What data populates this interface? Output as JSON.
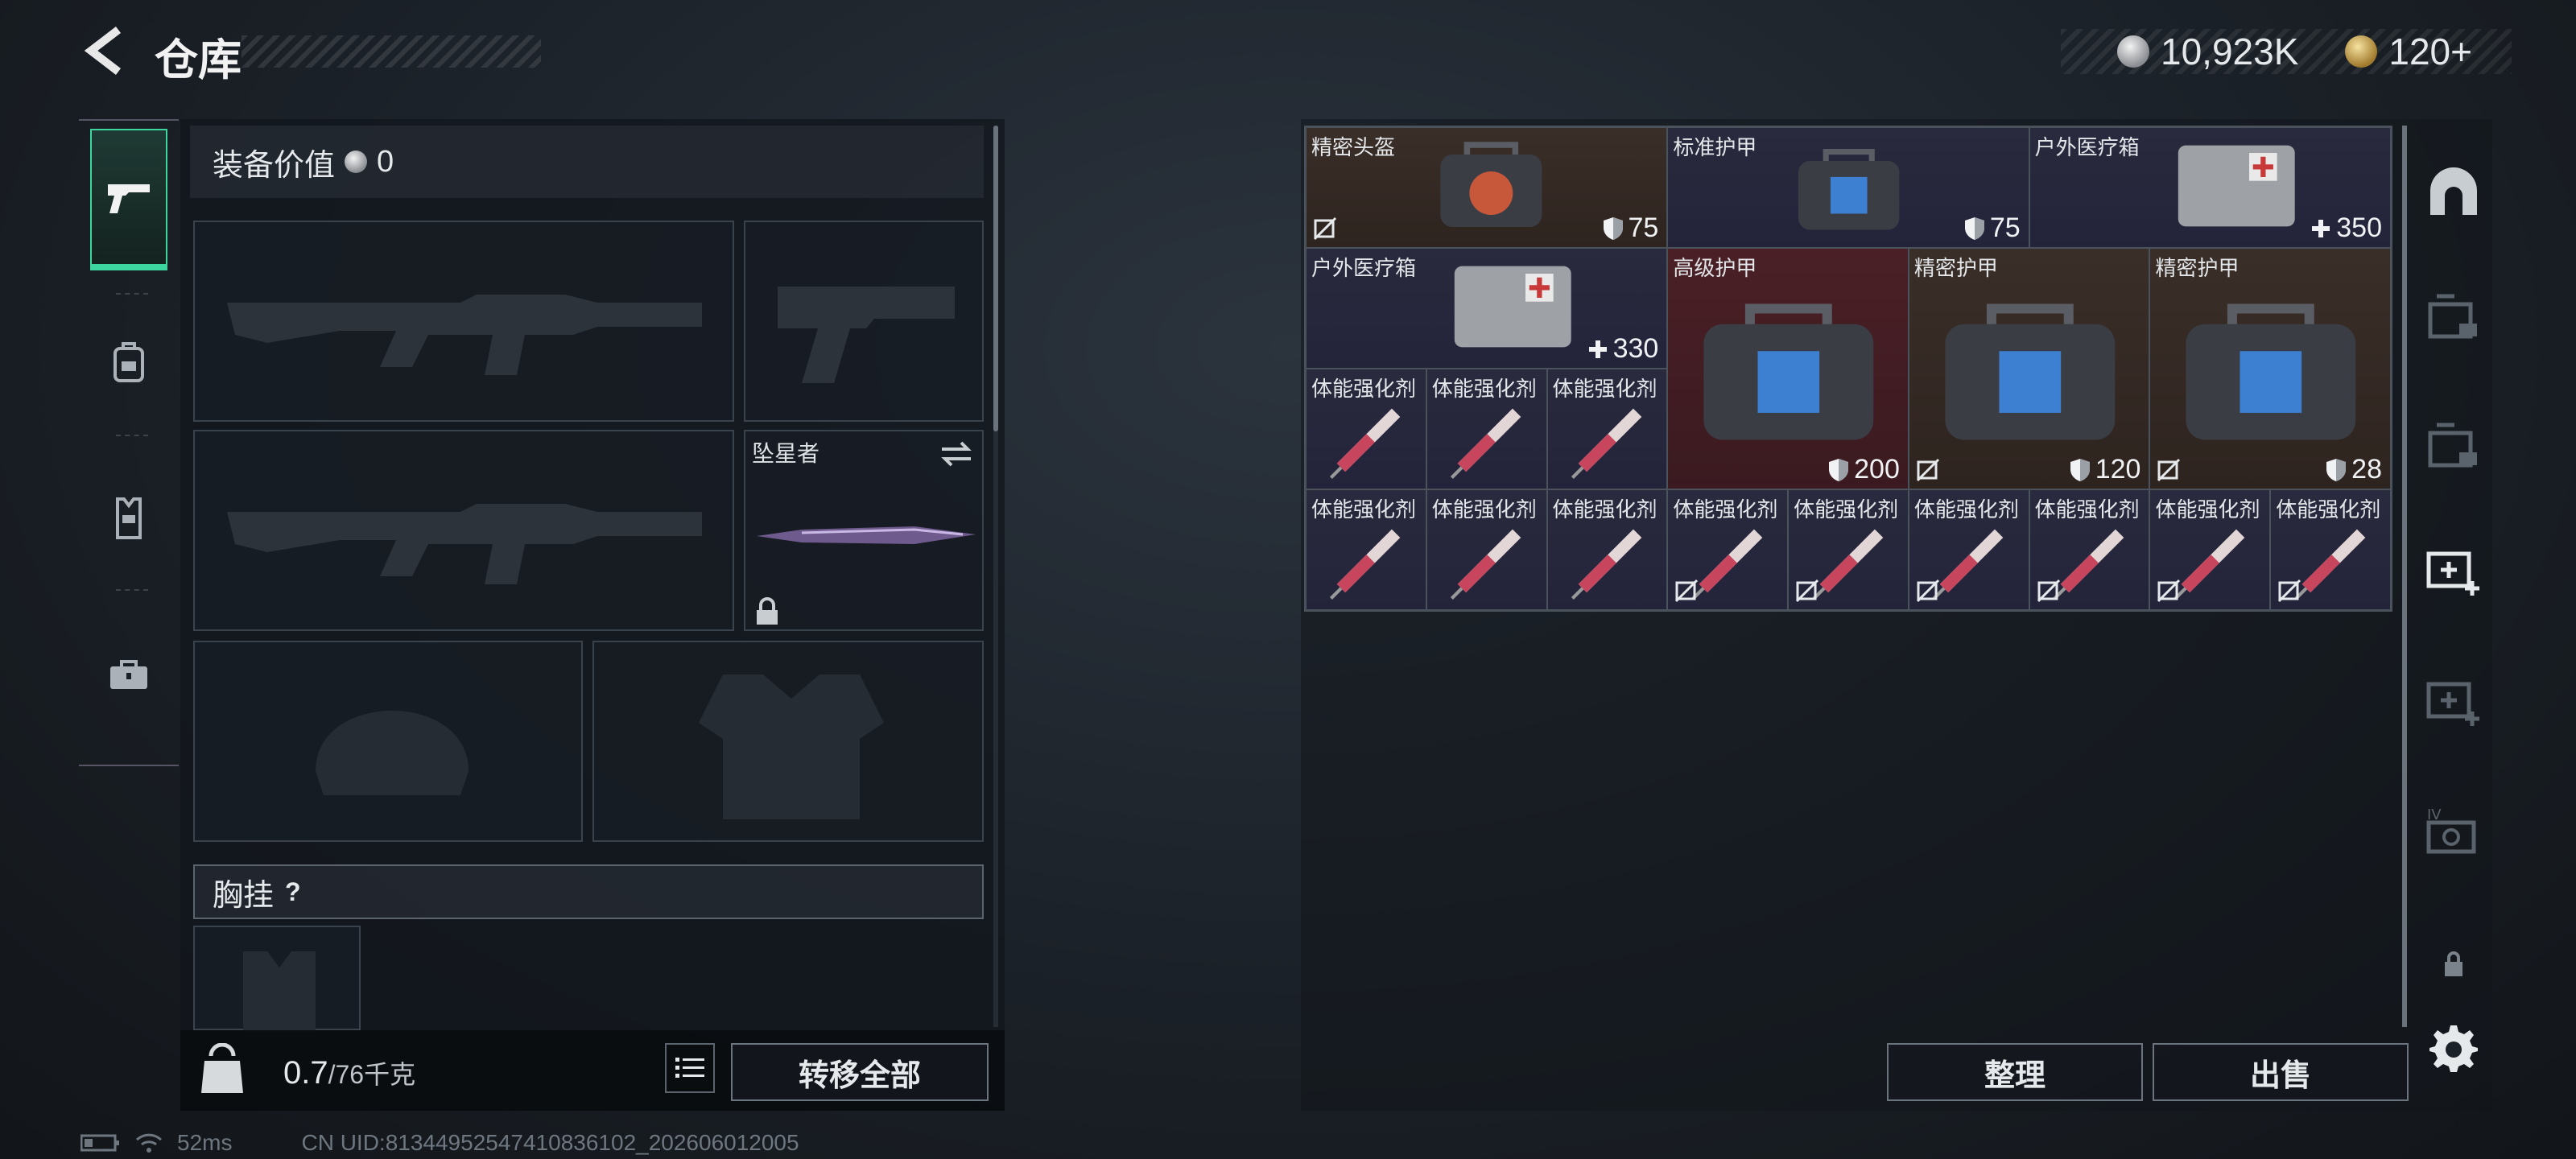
{
  "header": {
    "title": "仓库"
  },
  "currency": {
    "silver": "10,923K",
    "gold": "120+"
  },
  "left_tabs": [
    {
      "icon": "pistol-icon",
      "active": true
    },
    {
      "icon": "backpack-icon",
      "active": false
    },
    {
      "icon": "vest-icon",
      "active": false
    },
    {
      "icon": "toolbox-icon",
      "active": false
    }
  ],
  "equip": {
    "value_label": "装备价值",
    "value": "0",
    "melee_name": "坠星者",
    "chest_label": "胸挂",
    "chest_help": "?"
  },
  "weight": {
    "current": "0.7",
    "max": "/76千克",
    "icon_text": "KG"
  },
  "buttons": {
    "transfer_all": "转移全部",
    "sort": "整理",
    "sell": "出售"
  },
  "status": {
    "ping": "52ms",
    "uid": "CN UID:8134495254741083610​2_202606012005"
  },
  "stash_items": [
    {
      "name": "精密头盔",
      "value": "75",
      "icon": "shield-icon",
      "no_lose": true
    },
    {
      "name": "标准护甲",
      "value": "75",
      "icon": "shield-icon",
      "no_lose": false
    },
    {
      "name": "户外医疗箱",
      "value": "350",
      "icon": "plus-icon",
      "no_lose": false
    },
    {
      "name": "户外医疗箱",
      "value": "330",
      "icon": "plus-icon",
      "no_lose": false
    },
    {
      "name": "高级护甲",
      "value": "200",
      "icon": "shield-icon",
      "no_lose": false
    },
    {
      "name": "精密护甲",
      "value": "120",
      "icon": "shield-icon",
      "no_lose": true
    },
    {
      "name": "精密护甲",
      "value": "28",
      "icon": "shield-icon",
      "no_lose": true
    },
    {
      "name": "体能强化剂"
    },
    {
      "name": "体能强化剂"
    },
    {
      "name": "体能强化剂"
    },
    {
      "name": "体能强化剂"
    },
    {
      "name": "体能强化剂"
    },
    {
      "name": "体能强化剂"
    },
    {
      "name": "体能强化剂",
      "no_lose": true
    },
    {
      "name": "体能强化剂",
      "no_lose": true
    },
    {
      "name": "体能强化剂",
      "no_lose": true
    },
    {
      "name": "体能强化剂",
      "no_lose": true
    },
    {
      "name": "体能强化剂",
      "no_lose": true
    },
    {
      "name": "体能强化剂",
      "no_lose": true
    }
  ]
}
